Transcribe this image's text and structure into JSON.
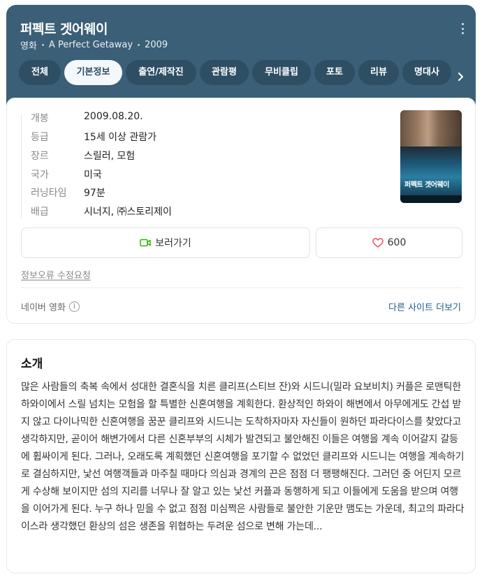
{
  "header": {
    "title": "퍼펙트 겟어웨이",
    "category": "영화",
    "english_title": "A Perfect Getaway",
    "year": "2009"
  },
  "tabs": [
    {
      "label": "전체",
      "active": false
    },
    {
      "label": "기본정보",
      "active": true
    },
    {
      "label": "출연/제작진",
      "active": false
    },
    {
      "label": "관람평",
      "active": false
    },
    {
      "label": "무비클립",
      "active": false
    },
    {
      "label": "포토",
      "active": false
    },
    {
      "label": "리뷰",
      "active": false
    },
    {
      "label": "명대사",
      "active": false
    }
  ],
  "info": [
    {
      "key": "개봉",
      "value": "2009.08.20."
    },
    {
      "key": "등급",
      "value": "15세 이상 관람가"
    },
    {
      "key": "장르",
      "value": "스릴러, 모험"
    },
    {
      "key": "국가",
      "value": "미국"
    },
    {
      "key": "러닝타임",
      "value": "97분"
    },
    {
      "key": "배급",
      "value": "시너지, ㈜스토리제이"
    }
  ],
  "poster": {
    "title_text": "퍼펙트 겟어웨이"
  },
  "actions": {
    "watch_label": "보러가기",
    "like_count": "600"
  },
  "links": {
    "report": "정보오류 수정요청",
    "source": "네이버 영화",
    "other_sites": "다른 사이트 더보기"
  },
  "intro": {
    "heading": "소개",
    "text": "많은 사람들의 축복 속에서 성대한 결혼식을 치른 클리프(스티브 잔)와 시드니(밀라 요보비치) 커플은 로맨틱한 하와이에서 스릴 넘치는 모험을 할 특별한 신혼여행을 계획한다. 환상적인 하와이 해변에서 아무에게도 간섭 받지 않고 다이나믹한 신혼여행을 꿈꾼 클리프와 시드니는 도착하자마자 자신들이 원하던 파라다이스를 찾았다고 생각하지만, 곧이어 해변가에서 다른 신혼부부의 시체가 발견되고 불안해진 이들은 여행을 계속 이어갈지 갈등에 휩싸이게 된다. 그러나, 오래도록 계획했던 신혼여행을 포기할 수 없었던 클리프와 시드니는 여행을 계속하기로 결심하지만, 낯선 여행객들과 마주칠 때마다 의심과 경계의 끈은 점점 더 팽팽해진다. 그러던 중 어딘지 모르게 수상해 보이지만 섬의 지리를 너무나 잘 알고 있는 낯선 커플과 동행하게 되고 이들에게 도움을 받으며 여행을 이어가게 된다. 누구 하나 믿을 수 없고 점점 미심쩍은 사람들로 불안한 기운만 맴도는 가운데, 최고의 파라다이스라 생각했던 환상의 섬은 생존을 위협하는 두려운 섬으로 변해 가는데..."
  },
  "colors": {
    "header_bg": "#3b5f77",
    "tab_bg": "#2e4e64",
    "active_tab_bg": "#f4f8fb",
    "link": "#245c8c",
    "watch_icon": "#2db400",
    "heart": "#e5505a"
  }
}
